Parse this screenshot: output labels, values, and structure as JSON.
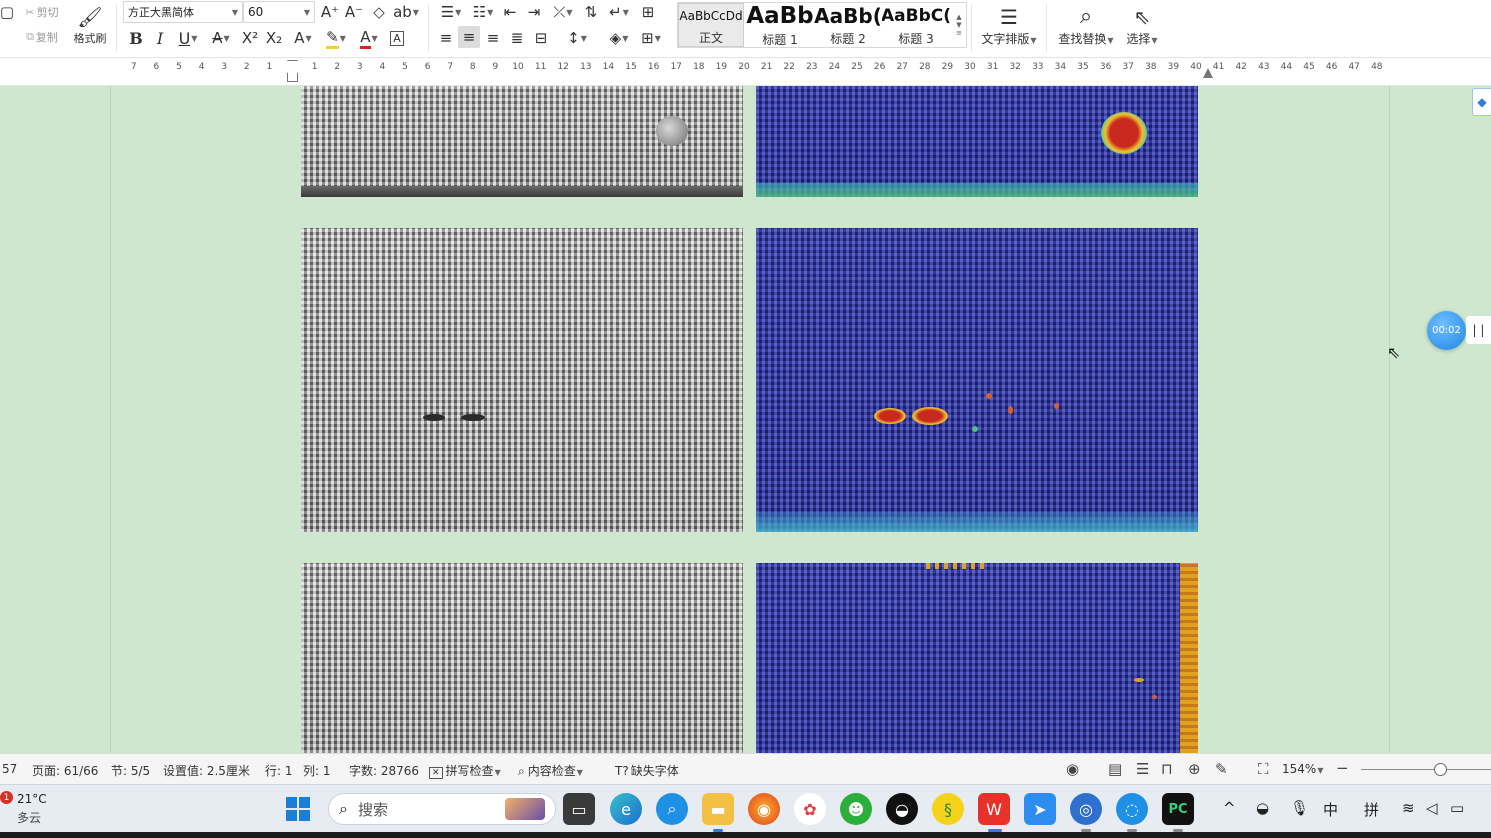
{
  "ribbon": {
    "cut_label": "剪切",
    "copy_label": "复制",
    "format_painter_label": "格式刷",
    "font_name": "方正大黑简体",
    "font_size": "60",
    "styles": [
      {
        "sample": "AaBbCcDd",
        "label": "正文"
      },
      {
        "sample": "AaBb",
        "label": "标题 1"
      },
      {
        "sample": "AaBb(",
        "label": "标题 2"
      },
      {
        "sample": "AaBbC(",
        "label": "标题 3"
      }
    ],
    "text_layout_label": "文字排版",
    "find_replace_label": "查找替换",
    "select_label": "选择"
  },
  "ruler": {
    "left_ticks": [
      "7",
      "6",
      "5",
      "4",
      "3",
      "2",
      "1"
    ],
    "right_ticks": [
      "1",
      "2",
      "3",
      "4",
      "5",
      "6",
      "7",
      "8",
      "9",
      "10",
      "11",
      "12",
      "13",
      "14",
      "15",
      "16",
      "17",
      "18",
      "19",
      "20",
      "21",
      "22",
      "23",
      "24",
      "25",
      "26",
      "27",
      "28",
      "29",
      "30",
      "31",
      "32",
      "33",
      "34",
      "35",
      "36",
      "37",
      "38",
      "39",
      "40",
      "41",
      "42",
      "43",
      "44",
      "45",
      "46",
      "47",
      "48"
    ]
  },
  "widgets": {
    "timer": "00:02",
    "pause": "| |"
  },
  "status": {
    "partial": "57",
    "page": "页面: 61/66",
    "section": "节: 5/5",
    "setting": "设置值: 2.5厘米",
    "row": "行: 1",
    "col": "列: 1",
    "word_count": "字数: 28766",
    "spell_check": "拼写检查",
    "content_check": "内容检查",
    "missing_font": "缺失字体",
    "zoom": "154%"
  },
  "taskbar": {
    "weather_badge": "1",
    "temperature": "21°C",
    "weather": "多云",
    "search_placeholder": "搜索",
    "ime_lang": "中",
    "ime_mode": "拼"
  },
  "colors": {
    "doc_bg": "#cfe7cf",
    "accent_blue": "#1f86e6",
    "wps_red": "#e8312b"
  }
}
